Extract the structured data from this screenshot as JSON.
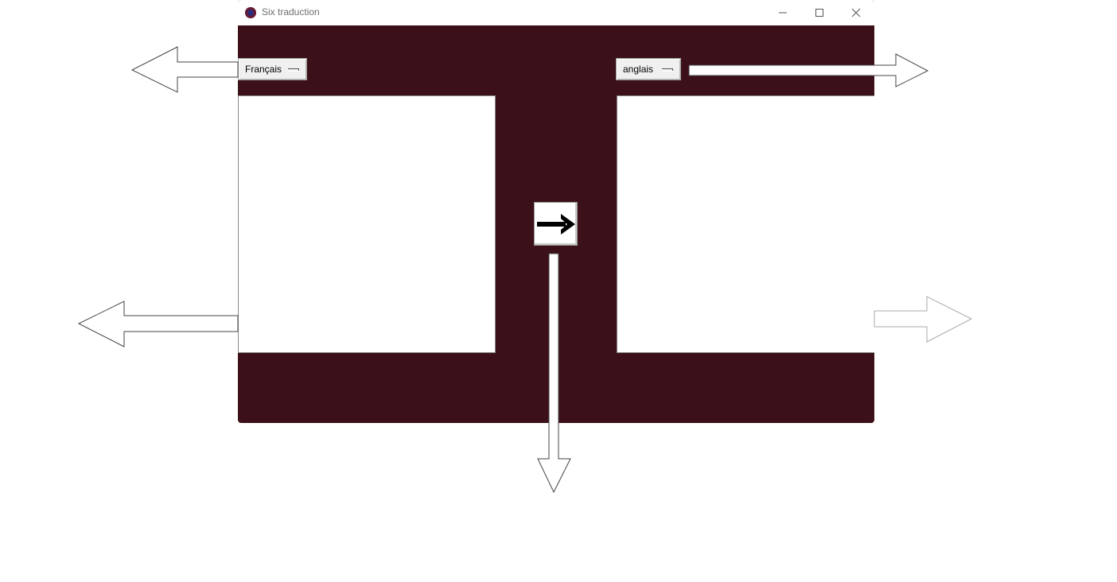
{
  "window": {
    "title": "Six traduction",
    "controls": {
      "minimize_icon": "minimize-icon",
      "maximize_icon": "maximize-icon",
      "close_icon": "close-icon"
    }
  },
  "source_language": {
    "selected": "Français"
  },
  "target_language": {
    "selected": "anglais"
  },
  "source_text": {
    "value": ""
  },
  "target_text": {
    "value": ""
  },
  "translate_button": {
    "icon": "right-arrow-icon"
  },
  "colors": {
    "window_background": "#3c1018",
    "text_area": "#ffffff",
    "button_face": "#f0f0f0"
  }
}
